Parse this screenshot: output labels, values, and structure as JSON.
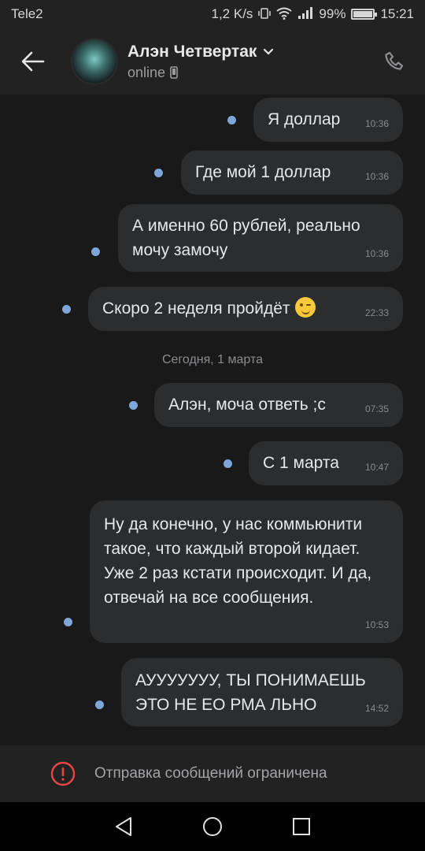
{
  "status_bar": {
    "carrier": "Tele2",
    "speed": "1,2 K/s",
    "battery": "99%",
    "battery_level": 0.99,
    "time": "15:21"
  },
  "header": {
    "contact_name": "Алэн Четвертак",
    "contact_status": "online",
    "icons": {
      "back": "arrow-left-icon",
      "dropdown": "chevron-down-icon",
      "device": "phone-device-icon",
      "call": "phone-call-icon"
    }
  },
  "messages": [
    {
      "text": "Я доллар",
      "time": "10:36"
    },
    {
      "text": "Где мой 1 доллар",
      "time": "10:36"
    },
    {
      "text": "А именно 60 рублей, реально мочу замочу",
      "time": "10:36"
    },
    {
      "text": "Скоро 2 неделя пройдёт",
      "emoji": "winking-face-emoji",
      "time": "22:33"
    },
    {
      "text": "Алэн, моча ответь ;с",
      "time": "07:35"
    },
    {
      "text": "С 1 марта",
      "time": "10:47"
    },
    {
      "text": "Ну да конечно, у нас коммьюнити такое, что каждый второй кидает. Уже 2 раз кстати происходит. И да, отвечай на все сообщения.",
      "time": "10:53"
    },
    {
      "text": "АУУУУУУУ, ТЫ ПОНИМАЕШЬ ЭТО НЕ ЕО РМА ЛЬНО",
      "time": "14:52"
    }
  ],
  "date_separator": "Сегодня, 1 марта",
  "restricted": {
    "text": "Отправка сообщений ограничена",
    "icon": "alert-circle-icon",
    "color": "#e64646"
  },
  "nav": {
    "back": "nav-back-icon",
    "home": "nav-home-icon",
    "recents": "nav-recents-icon"
  },
  "colors": {
    "bubble": "#2c2d2e",
    "unread_dot": "#7ea6d9",
    "background": "#19191a",
    "bar": "#222223"
  }
}
